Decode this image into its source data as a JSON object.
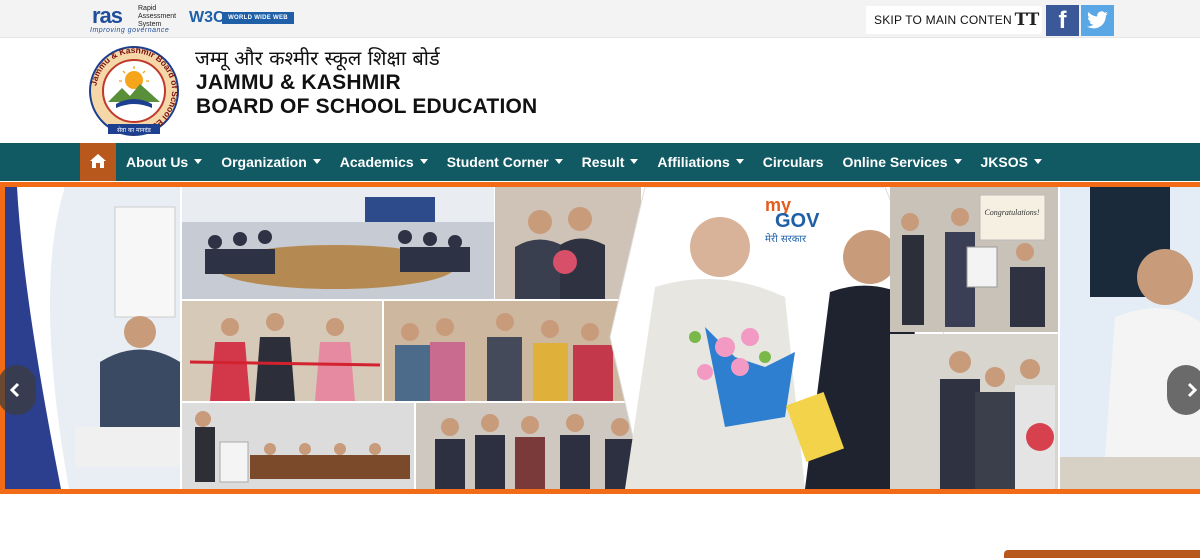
{
  "topbar": {
    "ras_logo": {
      "mark": "ras",
      "name": "Rapid Assessment System",
      "tagline": "Improving governance"
    },
    "w3c_logo": {
      "mark": "W3C",
      "badge": "WORLD WIDE WEB"
    },
    "skip_link": "SKIP TO MAIN CONTENT",
    "text_size_icon": "text-resize-icon",
    "text_size_glyph": "TT",
    "social": [
      {
        "name": "facebook-icon",
        "glyph": "f",
        "color": "#3b5998"
      },
      {
        "name": "twitter-icon",
        "color": "#5aa7e6"
      }
    ]
  },
  "header": {
    "title_hindi": "जम्मू और कश्मीर स्कूल शिक्षा बोर्ड",
    "title_line1": "JAMMU & KASHMIR",
    "title_line2": "BOARD OF SCHOOL EDUCATION",
    "logo_ring_text": "Jammu & Kashmir Board of School Education",
    "logo_motto": "सेवा का मानदंड"
  },
  "nav": {
    "home_icon": "home-icon",
    "items": [
      {
        "label": "About Us",
        "dropdown": true
      },
      {
        "label": "Organization",
        "dropdown": true
      },
      {
        "label": "Academics",
        "dropdown": true
      },
      {
        "label": "Student Corner",
        "dropdown": true
      },
      {
        "label": "Result",
        "dropdown": true
      },
      {
        "label": "Affiliations",
        "dropdown": true
      },
      {
        "label": "Circulars",
        "dropdown": false
      },
      {
        "label": "Online Services",
        "dropdown": true
      },
      {
        "label": "JKSOS",
        "dropdown": true
      }
    ]
  },
  "slider": {
    "mygov_logo": {
      "my": "my",
      "gov": "GOV",
      "tagline": "मेरी सरकार"
    },
    "certificate_text": "Congratulations!",
    "prev_icon": "chevron-left-icon",
    "next_icon": "chevron-right-icon"
  },
  "colors": {
    "topbar_bg": "#f3f3f3",
    "nav_bg": "#125a63",
    "nav_home_bg": "#b8581d",
    "slider_border": "#f26b17",
    "title_text": "#111111"
  }
}
